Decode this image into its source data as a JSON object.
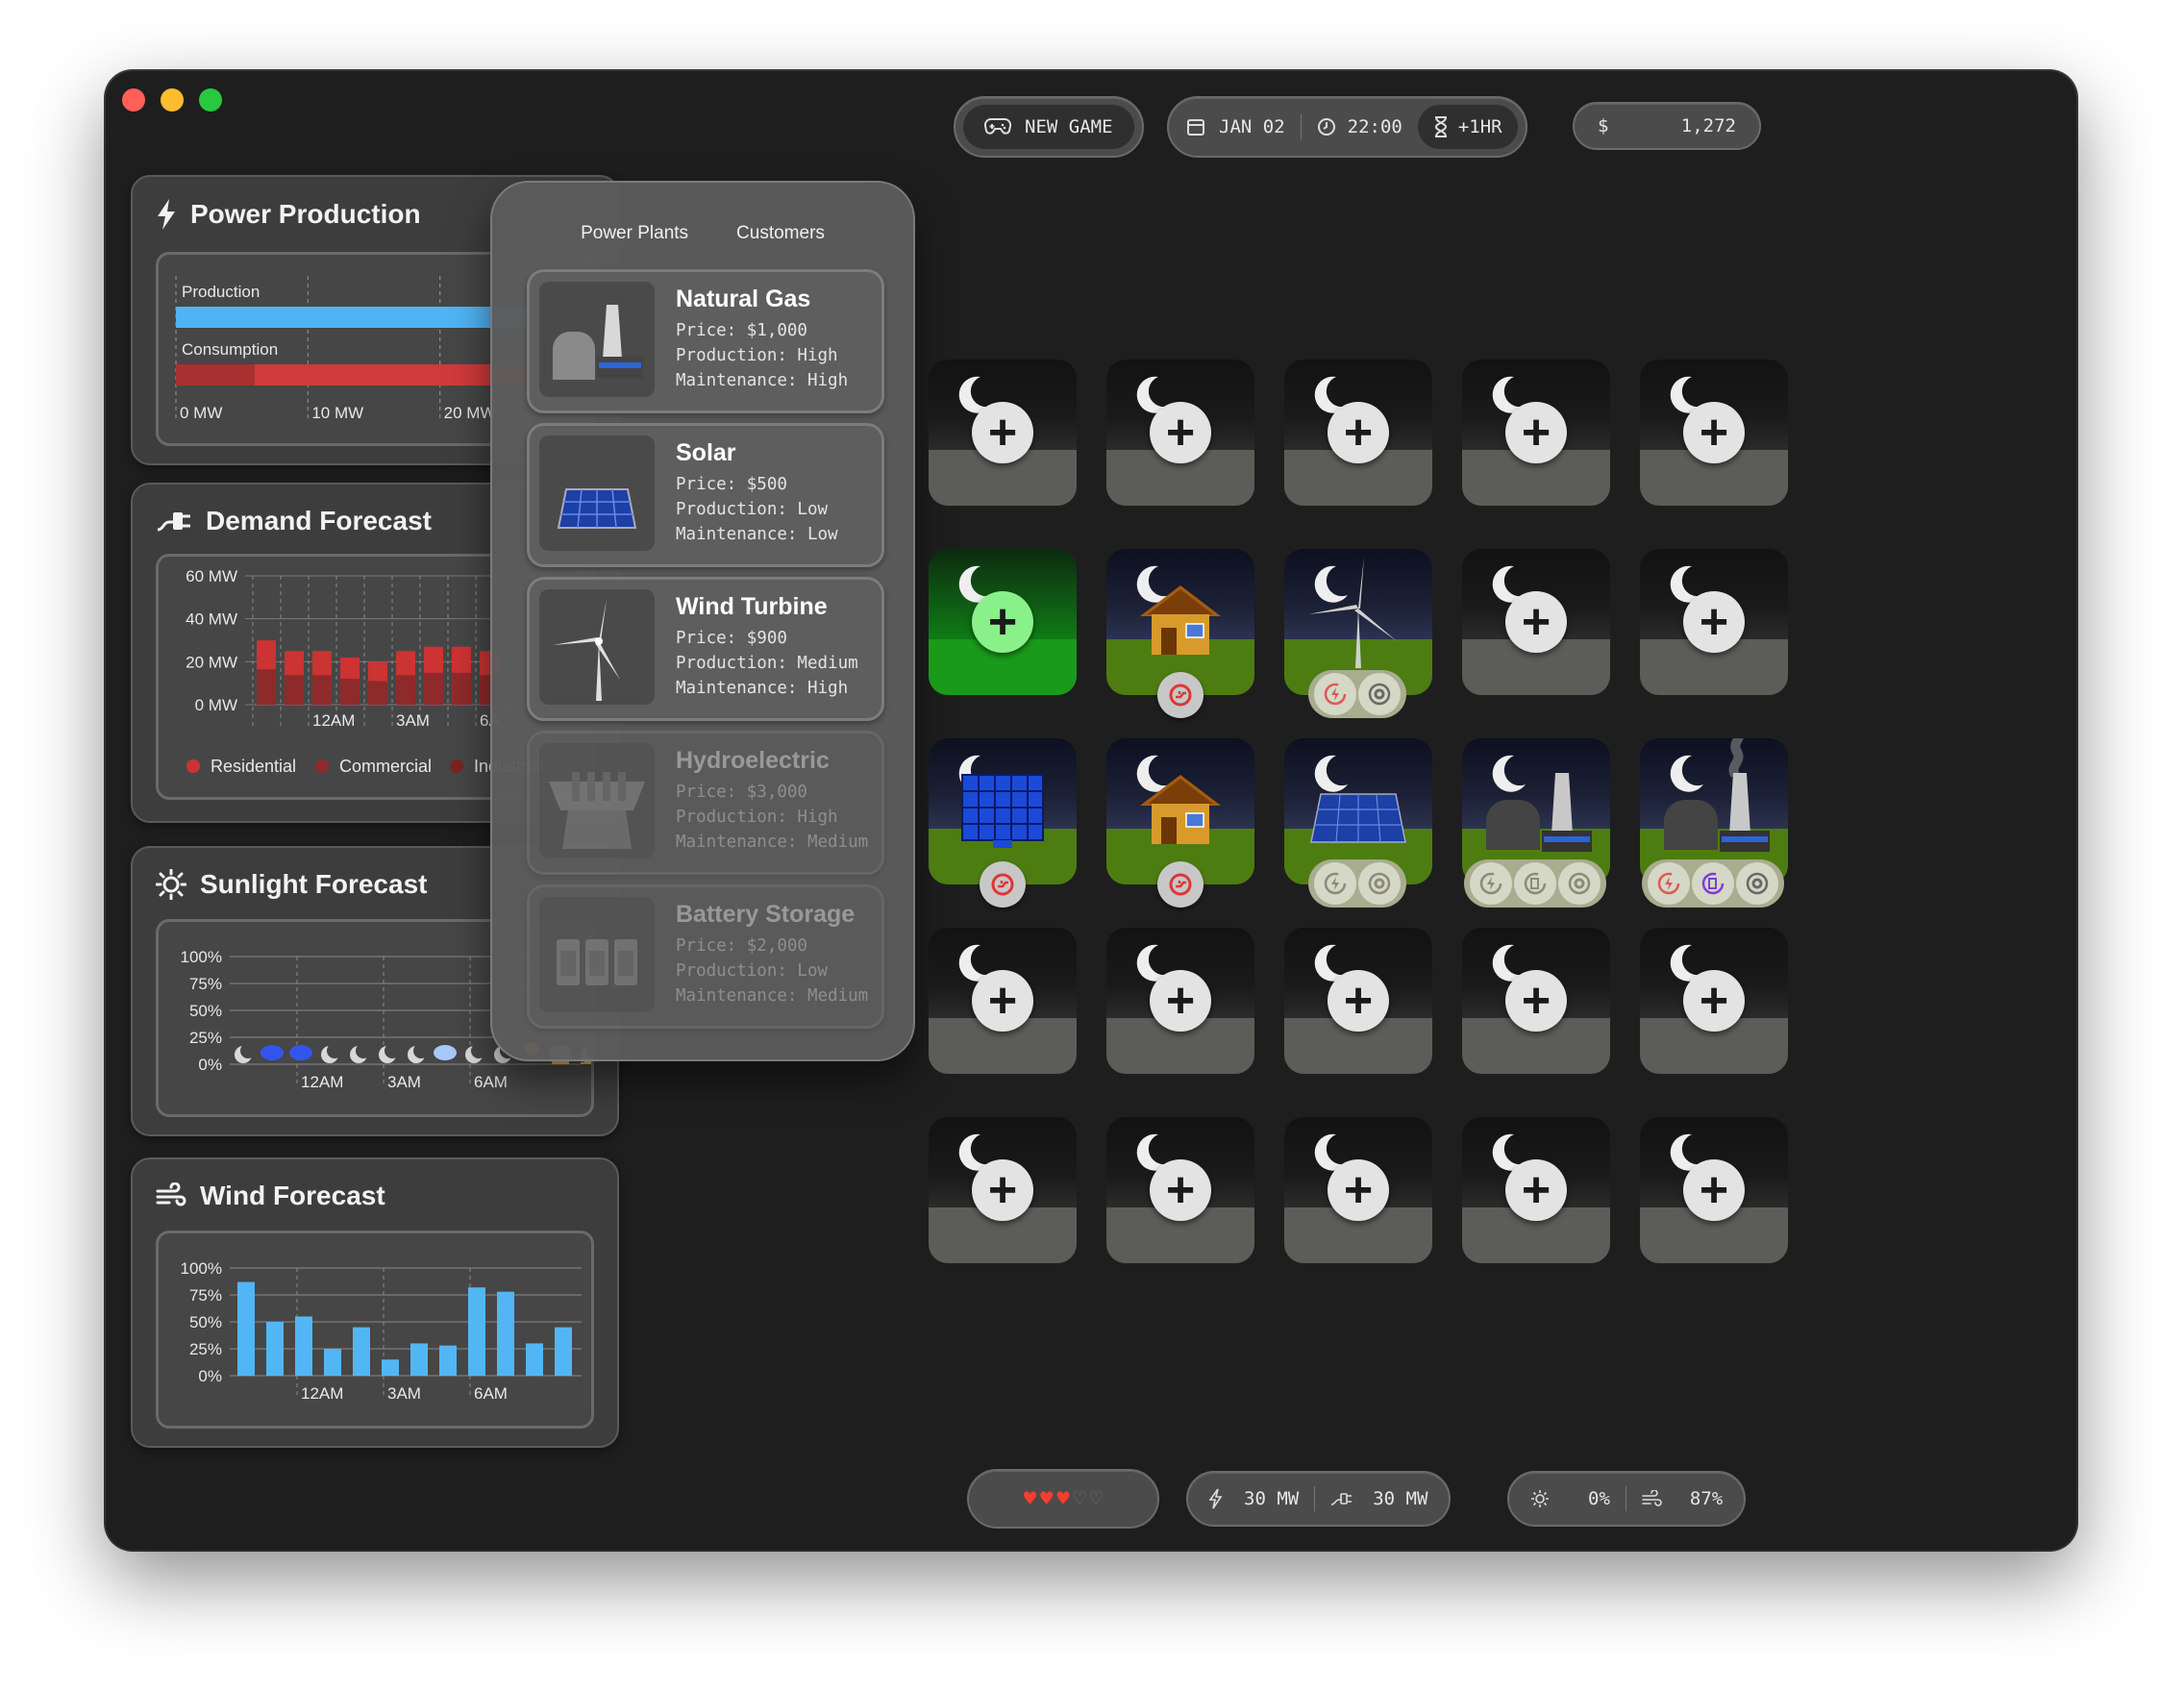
{
  "toolbar": {
    "new_game_label": "NEW GAME",
    "date": "JAN 02",
    "time": "22:00",
    "advance_label": "+1HR",
    "currency_symbol": "$",
    "money": "1,272"
  },
  "panels": {
    "power_production": {
      "title": "Power Production",
      "production_label": "Production",
      "consumption_label": "Consumption",
      "tick_labels": [
        "0 MW",
        "10 MW",
        "20 MW"
      ]
    },
    "demand_forecast": {
      "title": "Demand Forecast",
      "legend": [
        "Residential",
        "Commercial",
        "Industrial"
      ]
    },
    "sunlight_forecast": {
      "title": "Sunlight Forecast"
    },
    "wind_forecast": {
      "title": "Wind Forecast"
    }
  },
  "chart_data": [
    {
      "type": "bar",
      "title": "Power Production",
      "categories": [
        "Production",
        "Consumption"
      ],
      "values": [
        30,
        30
      ],
      "x_ticks": [
        "0 MW",
        "10 MW",
        "20 MW"
      ],
      "xlim": [
        0,
        30
      ],
      "colors": [
        "#4fb4f5",
        "#d03a3a"
      ]
    },
    {
      "type": "bar",
      "title": "Demand Forecast",
      "y_ticks": [
        "60 MW",
        "40 MW",
        "20 MW",
        "0 MW"
      ],
      "ylim": [
        0,
        60
      ],
      "x_ticks": [
        "12AM",
        "3AM",
        "6A"
      ],
      "values": [
        30,
        25,
        25,
        22,
        20,
        25,
        27,
        27,
        25
      ],
      "legend": [
        "Residential",
        "Commercial",
        "Industrial"
      ],
      "colors": [
        "#cc3333",
        "#8f2a2a",
        "#7a2323"
      ]
    },
    {
      "type": "bar",
      "title": "Sunlight Forecast",
      "y_ticks": [
        "100%",
        "75%",
        "50%",
        "25%",
        "0%"
      ],
      "ylim": [
        0,
        100
      ],
      "x_ticks": [
        "12AM",
        "3AM",
        "6AM"
      ],
      "values": [
        0,
        0,
        0,
        0,
        0,
        0,
        0,
        0,
        0,
        0,
        0,
        5,
        2,
        0
      ],
      "weather": [
        "night",
        "rain",
        "rain",
        "night",
        "night",
        "night",
        "night",
        "snow",
        "night",
        "night",
        "sun",
        "cloud",
        "night",
        "night"
      ],
      "colors": [
        "#e8b830"
      ]
    },
    {
      "type": "bar",
      "title": "Wind Forecast",
      "y_ticks": [
        "100%",
        "75%",
        "50%",
        "25%",
        "0%"
      ],
      "ylim": [
        0,
        100
      ],
      "x_ticks": [
        "12AM",
        "3AM",
        "6AM"
      ],
      "values": [
        87,
        50,
        55,
        25,
        45,
        15,
        30,
        28,
        82,
        78,
        30,
        45
      ],
      "colors": [
        "#52b6f5"
      ]
    }
  ],
  "popup": {
    "tabs": [
      "Power Plants",
      "Customers"
    ],
    "plants": [
      {
        "name": "Natural Gas",
        "price": "Price: $1,000",
        "production": "Production: High",
        "maintenance": "Maintenance: High",
        "icon": "gas-plant-icon"
      },
      {
        "name": "Solar",
        "price": "Price: $500",
        "production": "Production: Low",
        "maintenance": "Maintenance: Low",
        "icon": "solar-panel-icon"
      },
      {
        "name": "Wind Turbine",
        "price": "Price: $900",
        "production": "Production: Medium",
        "maintenance": "Maintenance: High",
        "icon": "wind-turbine-icon"
      },
      {
        "name": "Hydroelectric",
        "price": "Price: $3,000",
        "production": "Production: High",
        "maintenance": "Maintenance: Medium",
        "icon": "dam-icon"
      },
      {
        "name": "Battery Storage",
        "price": "Price: $2,000",
        "production": "Production: Low",
        "maintenance": "Maintenance: Medium",
        "icon": "battery-icon"
      }
    ]
  },
  "grid": [
    [
      "empty",
      "empty",
      "empty",
      "empty",
      "empty"
    ],
    [
      "selected",
      "house",
      "wind",
      "empty",
      "empty"
    ],
    [
      "solar-big",
      "house",
      "solar",
      "gas",
      "gas-smoke"
    ],
    [
      "empty",
      "empty",
      "empty",
      "empty",
      "empty"
    ],
    [
      "empty",
      "empty",
      "empty",
      "empty",
      "empty"
    ]
  ],
  "status_bar": {
    "hearts_total": 5,
    "hearts_filled": 3,
    "production": "30 MW",
    "demand": "30 MW",
    "sunlight": "0%",
    "wind": "87%"
  },
  "colors": {
    "accent_blue": "#4fb4f5",
    "accent_red": "#d03a3a",
    "grass": "#4d7d10",
    "heart": "#ff3b30"
  }
}
